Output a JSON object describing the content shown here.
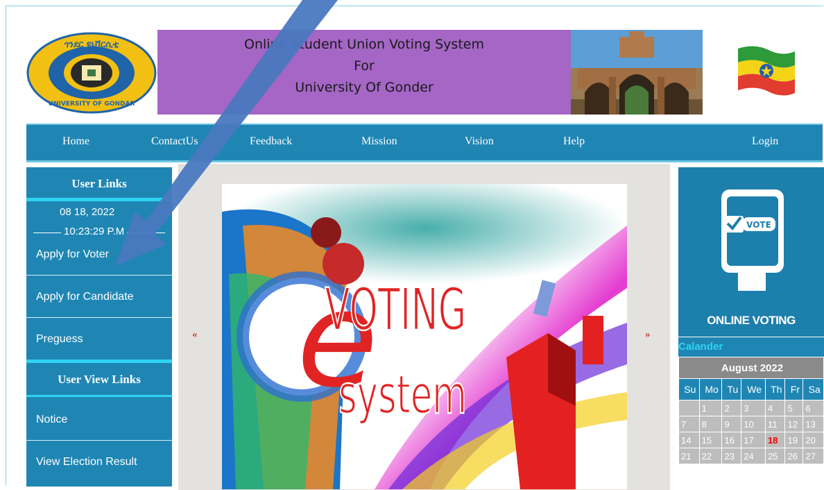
{
  "header": {
    "title_line1": "Online Student Union Voting System",
    "title_line2": "For",
    "title_line3": "University Of Gonder",
    "logo_text_top": "ጎንደር ዩኒቨርሲቲ",
    "logo_text_bottom": "UNIVERSITY OF GONDAR"
  },
  "nav": {
    "items": [
      "Home",
      "ContactUs",
      "Feedback",
      "Mission",
      "Vision",
      "Help",
      "Login"
    ]
  },
  "sidebar": {
    "user_links_title": "User Links",
    "date": "08 18, 2022",
    "time": "10:23:29 P.M",
    "links": [
      "Apply for Voter",
      "Apply for Candidate",
      "Preguess"
    ],
    "user_view_title": "User View Links",
    "view_links": [
      "Notice",
      "View Election Result"
    ]
  },
  "slider": {
    "prev_label": "«",
    "next_label": "»",
    "slide_text_voting": "VOTING",
    "slide_text_system": "system",
    "slide_text_e": "e"
  },
  "vote_panel": {
    "badge": "VOTE",
    "caption": "ONLINE VOTING"
  },
  "calendar": {
    "label": "Calander",
    "month": "August 2022",
    "days_of_week": [
      "Su",
      "Mo",
      "Tu",
      "We",
      "Th",
      "Fr",
      "Sa"
    ],
    "weeks": [
      [
        "",
        "1",
        "2",
        "3",
        "4",
        "5",
        "6"
      ],
      [
        "7",
        "8",
        "9",
        "10",
        "11",
        "12",
        "13"
      ],
      [
        "14",
        "15",
        "16",
        "17",
        "18",
        "19",
        "20"
      ],
      [
        "21",
        "22",
        "23",
        "24",
        "25",
        "26",
        "27"
      ]
    ],
    "today": "18"
  },
  "colors": {
    "nav_blue": "#1f86b4",
    "banner_purple": "#a566c6",
    "accent_cyan": "#2ed3f3",
    "annotation_arrow": "#4a78c0"
  }
}
